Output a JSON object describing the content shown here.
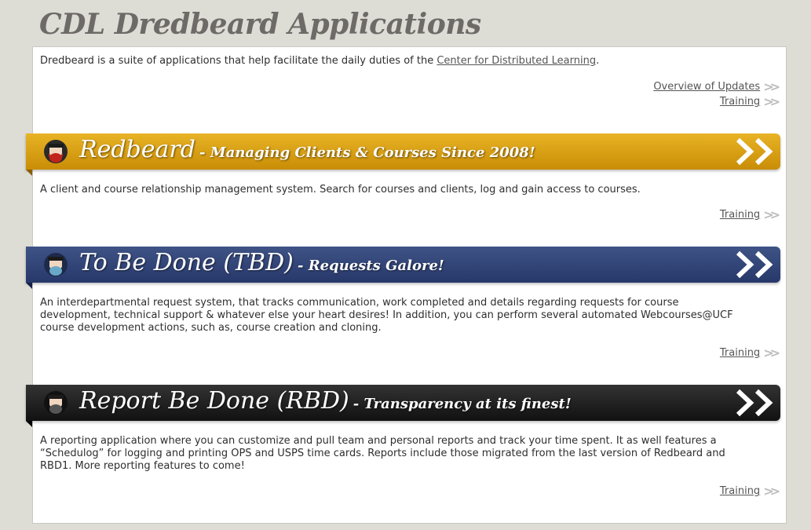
{
  "page": {
    "title": "CDL Dredbeard Applications"
  },
  "intro": {
    "text": "Dredbeard is a suite of applications that help facilitate the daily duties of the",
    "link": "Center for Distributed Learning",
    "suffix": "."
  },
  "top_links": {
    "overview": "Overview of Updates",
    "training": "Training"
  },
  "apps": [
    {
      "name": "Redbeard",
      "tagline": "- Managing Clients & Courses Since 2008!",
      "description": "A client and course relationship management system. Search for courses and clients, log and gain access to courses.",
      "training": "Training",
      "color": "#d8a010"
    },
    {
      "name": "To Be Done (TBD)",
      "tagline": "- Requests Galore!",
      "description": "An interdepartmental request system, that tracks communication, work completed and details regarding requests for course development, technical support & whatever else your heart desires! In addition, you can perform several automated Webcourses@UCF course development actions, such as, course creation and cloning.",
      "training": "Training",
      "color": "#34477a"
    },
    {
      "name": "Report Be Done (RBD)",
      "tagline": "- Transparency at its finest!",
      "description": "A reporting application where you can customize and pull team and personal reports and track your time spent. It as well features a “Schedulog” for logging and printing OPS and USPS time cards. Reports include those migrated from the last version of Redbeard and RBD1. More reporting features to come!",
      "training": "Training",
      "color": "#222222"
    }
  ]
}
